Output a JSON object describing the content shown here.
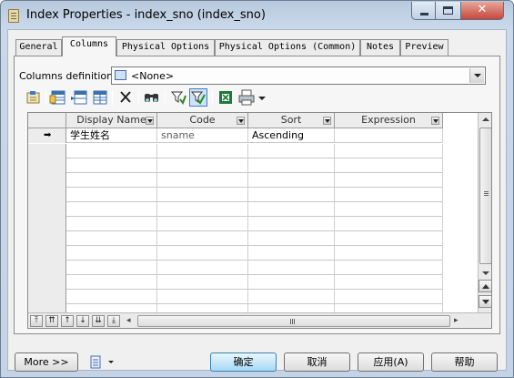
{
  "window": {
    "title": "Index Properties - index_sno (index_sno)"
  },
  "tabs": [
    {
      "label": "General",
      "active": false
    },
    {
      "label": "Columns",
      "active": true
    },
    {
      "label": "Physical Options",
      "active": false
    },
    {
      "label": "Physical Options (Common)",
      "active": false
    },
    {
      "label": "Notes",
      "active": false
    },
    {
      "label": "Preview",
      "active": false
    }
  ],
  "columns_definition": {
    "label": "Columns definition:",
    "value": "<None>"
  },
  "toolbar": {
    "icons": [
      "properties-icon",
      "add-columns-icon",
      "insert-row-icon",
      "add-row-icon",
      "delete-icon",
      "find-icon",
      "filter-icon",
      "filter-active-icon",
      "excel-icon",
      "print-icon",
      "dropdown-icon"
    ]
  },
  "grid": {
    "headers": [
      "Display Name",
      "Code",
      "Sort",
      "Expression"
    ],
    "rows": [
      {
        "name": "学生姓名",
        "code": "sname",
        "sort": "Ascending",
        "expression": ""
      }
    ],
    "empty_rows": 12,
    "nav_buttons": [
      "first",
      "page-up",
      "up",
      "down",
      "page-down",
      "last"
    ]
  },
  "buttons": {
    "more": "More >>",
    "ok": "确定",
    "cancel": "取消",
    "apply": "应用(A)",
    "help": "帮助"
  },
  "colors": {
    "title_bar": "#c9d9ea",
    "close_button": "#c8473a",
    "default_button": "#a7d9f5"
  }
}
